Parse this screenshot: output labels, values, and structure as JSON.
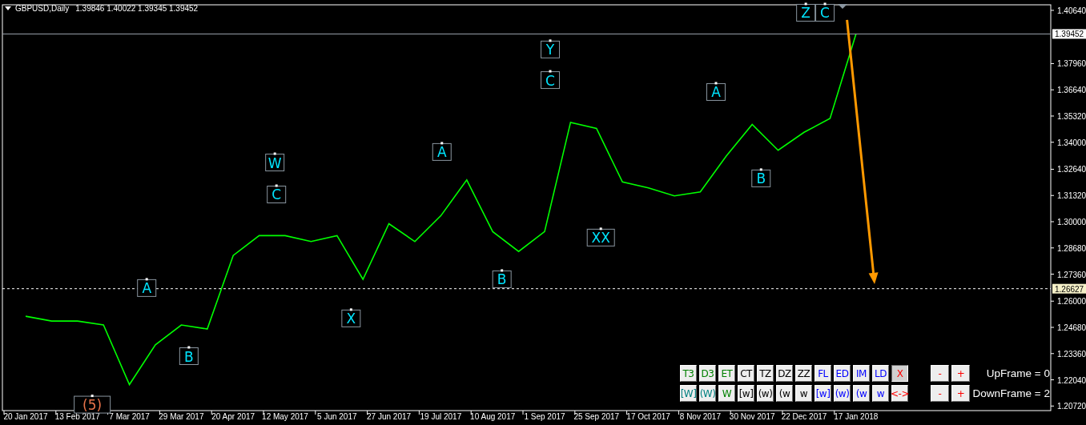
{
  "header": {
    "symbol": "GBPUSD,Daily",
    "quotes": "1.39846 1.40022 1.39345 1.39452"
  },
  "chart_data": {
    "type": "line",
    "ylim": [
      1.2049,
      1.4092
    ],
    "categories": [
      "20 Jan 2017",
      null,
      "13 Feb 2017",
      null,
      "7 Mar 2017",
      null,
      "29 Mar 2017",
      null,
      "20 Apr 2017",
      null,
      "12 May 2017",
      null,
      "5 Jun 2017",
      null,
      "27 Jun 2017",
      null,
      "19 Jul 2017",
      null,
      "10 Aug 2017",
      null,
      "1 Sep 2017",
      null,
      "25 Sep 2017",
      null,
      "17 Oct 2017",
      null,
      "8 Nov 2017",
      null,
      "30 Nov 2017",
      null,
      "22 Dec 2017",
      null,
      "17 Jan 2018"
    ],
    "series": [
      {
        "color": "#00ff00",
        "values": [
          1.2524,
          1.25,
          1.25,
          1.248,
          1.218,
          1.238,
          1.248,
          1.246,
          1.283,
          1.293,
          1.293,
          1.29,
          1.293,
          1.271,
          1.299,
          1.29,
          1.303,
          1.321,
          1.295,
          1.285,
          1.295,
          1.35,
          1.347,
          1.32,
          1.317,
          1.313,
          1.315,
          1.333,
          1.349,
          1.336,
          1.345,
          1.352,
          1.3945
        ]
      }
    ],
    "yticks": [
      {
        "value": 1.4064,
        "label": "1.40640"
      },
      {
        "value": 1.3796,
        "label": "1.37960"
      },
      {
        "value": 1.3664,
        "label": "1.36640"
      },
      {
        "value": 1.3532,
        "label": "1.35320"
      },
      {
        "value": 1.34,
        "label": "1.34000"
      },
      {
        "value": 1.3264,
        "label": "1.32640"
      },
      {
        "value": 1.3132,
        "label": "1.31320"
      },
      {
        "value": 1.3,
        "label": "1.30000"
      },
      {
        "value": 1.2868,
        "label": "1.28680"
      },
      {
        "value": 1.2736,
        "label": "1.27360"
      },
      {
        "value": 1.26,
        "label": "1.26000"
      },
      {
        "value": 1.2468,
        "label": "1.24680"
      },
      {
        "value": 1.2336,
        "label": "1.23360"
      },
      {
        "value": 1.2204,
        "label": "1.22040"
      },
      {
        "value": 1.2072,
        "label": "1.20720"
      }
    ],
    "ref_lines": [
      {
        "axis": "y",
        "value": 1.39452,
        "label": "1.39452"
      },
      {
        "axis": "y",
        "value": 1.26627,
        "label": "1.26627"
      }
    ]
  },
  "arrow": {
    "color": "#ff9900"
  },
  "wave_labels": [
    {
      "text": "A",
      "color": "#00e5ff"
    },
    {
      "text": "B",
      "color": "#00e5ff"
    },
    {
      "text": "W",
      "color": "#00e5ff"
    },
    {
      "text": "C",
      "color": "#00e5ff"
    },
    {
      "text": "X",
      "color": "#00e5ff"
    },
    {
      "text": "A",
      "color": "#00e5ff"
    },
    {
      "text": "B",
      "color": "#00e5ff"
    },
    {
      "text": "Y",
      "color": "#00e5ff"
    },
    {
      "text": "C",
      "color": "#00e5ff"
    },
    {
      "text": "XX",
      "color": "#00e5ff"
    },
    {
      "text": "A",
      "color": "#00e5ff"
    },
    {
      "text": "B",
      "color": "#00e5ff"
    },
    {
      "text": "Z",
      "color": "#00e5ff"
    },
    {
      "text": "C",
      "color": "#00e5ff"
    },
    {
      "text": "(5)",
      "color": "#e8734a"
    }
  ],
  "panel": {
    "rows": [
      {
        "buttons": [
          {
            "label": "T3",
            "color": "#008000",
            "pressed": false
          },
          {
            "label": "D3",
            "color": "#008000",
            "pressed": false
          },
          {
            "label": "ET",
            "color": "#008000",
            "pressed": false
          },
          {
            "label": "CT",
            "color": "#000000",
            "pressed": false
          },
          {
            "label": "TZ",
            "color": "#000000",
            "pressed": false
          },
          {
            "label": "DZ",
            "color": "#000000",
            "pressed": false
          },
          {
            "label": "ZZ",
            "color": "#000000",
            "pressed": false
          },
          {
            "label": "FL",
            "color": "#0000ff",
            "pressed": false
          },
          {
            "label": "ED",
            "color": "#0000ff",
            "pressed": false
          },
          {
            "label": "IM",
            "color": "#0000ff",
            "pressed": false
          },
          {
            "label": "LD",
            "color": "#0000ff",
            "pressed": false
          },
          {
            "label": "X",
            "color": "#ff0000",
            "pressed": true
          }
        ],
        "minus": "-",
        "plus": "+",
        "frame": "UpFrame = 0"
      },
      {
        "buttons": [
          {
            "label": "[W]",
            "color": "#008080",
            "pressed": false
          },
          {
            "label": "(W)",
            "color": "#008080",
            "pressed": false
          },
          {
            "label": "W",
            "color": "#008000",
            "pressed": false
          },
          {
            "label": "[w]",
            "color": "#000000",
            "pressed": false
          },
          {
            "label": "(w)",
            "color": "#000000",
            "pressed": false
          },
          {
            "label": "(w",
            "color": "#000000",
            "pressed": false
          },
          {
            "label": "w",
            "color": "#000000",
            "pressed": false
          },
          {
            "label": "[w]",
            "color": "#0000ff",
            "pressed": false
          },
          {
            "label": "(w)",
            "color": "#0000ff",
            "pressed": false
          },
          {
            "label": "(w",
            "color": "#0000ff",
            "pressed": false
          },
          {
            "label": "w",
            "color": "#0000ff",
            "pressed": false
          },
          {
            "label": "<->",
            "color": "#ff0000",
            "pressed": false
          }
        ],
        "minus": "-",
        "plus": "+",
        "frame": "DownFrame = 2"
      }
    ]
  }
}
